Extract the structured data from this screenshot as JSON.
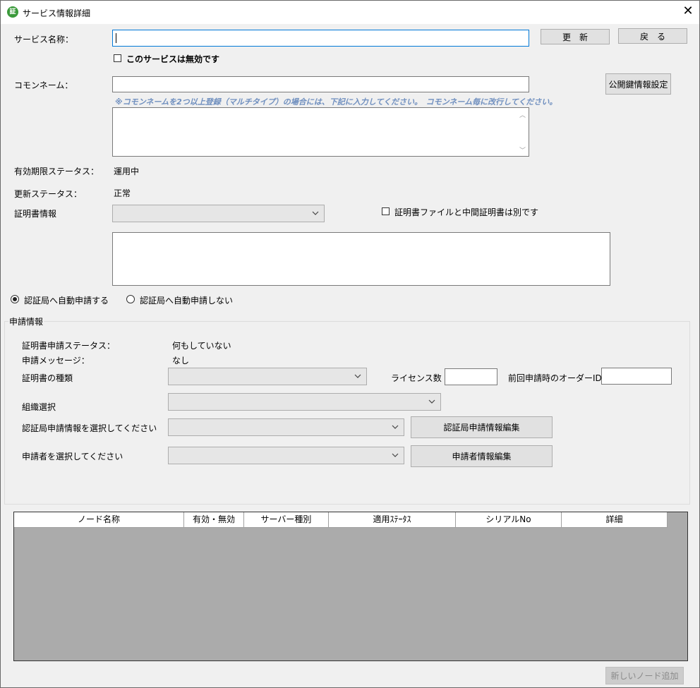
{
  "window": {
    "title": "サービス情報詳細",
    "app_icon_text": "証"
  },
  "form": {
    "service_name_label": "サービス名称：",
    "service_name_value": "",
    "update_button": "更　新",
    "back_button": "戻　る",
    "disable_checkbox_label": "このサービスは無効です",
    "common_name_label": "コモンネーム：",
    "common_name_value": "",
    "public_key_button": "公開鍵情報設定",
    "multi_hint": "※コモンネームを2つ以上登録（マルチタイプ）の場合には、下記に入力してください。　コモンネーム毎に改行してください。",
    "multi_textarea_value": "",
    "expiry_status_label": "有効期限ステータス：",
    "expiry_status_value": "運用中",
    "renew_status_label": "更新ステータス：",
    "renew_status_value": "正常",
    "cert_info_label": "証明書情報",
    "cert_info_selected": "",
    "separate_cert_label": "証明書ファイルと中間証明書は別です",
    "cert_textarea_value": "",
    "auto_apply_label": "認証局へ自動申請する",
    "no_auto_apply_label": "認証局へ自動申請しない"
  },
  "application": {
    "group_title": "申請情報",
    "cert_status_label": "証明書申請ステータス：",
    "cert_status_value": "何もしていない",
    "message_label": "申請メッセージ：",
    "message_value": "なし",
    "cert_type_label": "証明書の種類",
    "license_label": "ライセンス数",
    "license_value": "",
    "prev_order_label": "前回申請時のオーダーID",
    "prev_order_value": "",
    "org_label": "組織選択",
    "ca_info_label": "認証局申請情報を選択してください",
    "ca_info_edit_button": "認証局申請情報編集",
    "applicant_label": "申請者を選択してください",
    "applicant_edit_button": "申請者情報編集"
  },
  "nodes": {
    "columns": [
      "ノード名称",
      "有効・無効",
      "サーバー種別",
      "適用ｽﾃｰﾀｽ",
      "シリアルNo",
      "詳細"
    ],
    "rows": [],
    "add_button": "新しいノード追加"
  },
  "colors": {
    "accent": "#0078d7",
    "hint": "#6f8fbf",
    "grid_bg": "#ababab"
  },
  "icons": [
    "app-icon",
    "close-icon",
    "chevron-down-icon",
    "scroll-up-icon",
    "scroll-down-icon"
  ]
}
